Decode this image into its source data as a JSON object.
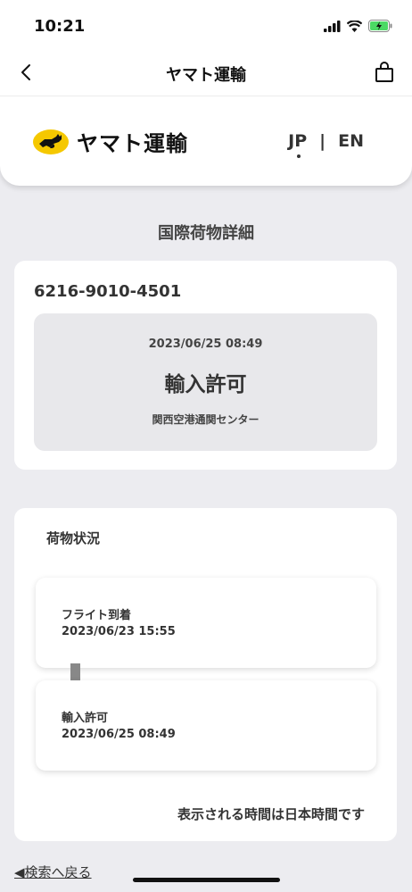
{
  "status_bar": {
    "time": "10:21"
  },
  "nav": {
    "title": "ヤマト運輸"
  },
  "header": {
    "logo_text": "ヤマト運輸",
    "lang_jp": "JP",
    "lang_sep": "|",
    "lang_en": "EN"
  },
  "page": {
    "section_title": "国際荷物詳細"
  },
  "shipment": {
    "tracking_number": "6216-9010-4501",
    "latest_date": "2023/06/25 08:49",
    "latest_status": "輸入許可",
    "latest_location": "関西空港通関センター"
  },
  "history": {
    "title": "荷物状況",
    "events": [
      {
        "label": "フライト到着",
        "datetime": "2023/06/23 15:55"
      },
      {
        "label": "輸入許可",
        "datetime": "2023/06/25 08:49"
      }
    ],
    "note": "表示される時間は日本時間です"
  },
  "footer": {
    "back_link": "◀検索へ戻る"
  },
  "colors": {
    "brand_yellow": "#f5c800",
    "background": "#ececf0"
  }
}
